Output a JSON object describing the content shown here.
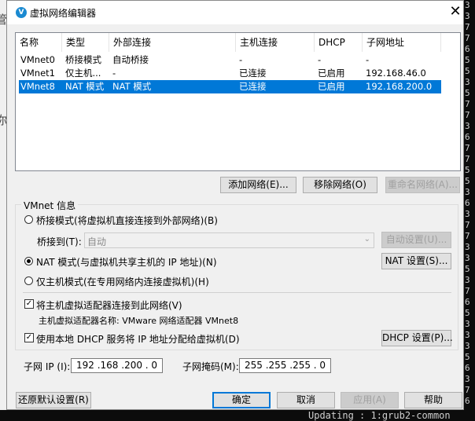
{
  "background": {
    "left_fragments": [
      "管",
      "你"
    ],
    "terminal_bottom": "Updating   : 1:grub2-common",
    "terminal_right": [
      "3",
      "3",
      "7",
      "7",
      "6",
      "5",
      "5",
      "3",
      "5",
      "7",
      "7",
      "3",
      "6",
      "7",
      "7",
      "5",
      "5",
      "3",
      "6",
      "3",
      "7",
      "7",
      "3",
      "3",
      "5",
      "3",
      "7",
      "6",
      "5",
      "3",
      "3",
      "3",
      "5",
      "6",
      "3",
      "7",
      "6"
    ]
  },
  "dialog": {
    "icon": "vmware-icon",
    "title": "虚拟网络编辑器",
    "close_glyph": "✕"
  },
  "list": {
    "columns": [
      "名称",
      "类型",
      "外部连接",
      "主机连接",
      "DHCP",
      "子网地址"
    ],
    "rows": [
      {
        "name": "VMnet0",
        "type": "桥接模式",
        "external": "自动桥接",
        "host": "-",
        "dhcp": "-",
        "subnet": "-",
        "selected": false
      },
      {
        "name": "VMnet1",
        "type": "仅主机...",
        "external": "-",
        "host": "已连接",
        "dhcp": "已启用",
        "subnet": "192.168.46.0",
        "selected": false
      },
      {
        "name": "VMnet8",
        "type": "NAT 模式",
        "external": "NAT 模式",
        "host": "已连接",
        "dhcp": "已启用",
        "subnet": "192.168.200.0",
        "selected": true
      }
    ]
  },
  "list_buttons": {
    "add": "添加网络(E)...",
    "remove": "移除网络(O)",
    "rename": "重命名网络(A)..."
  },
  "vmnet_info": {
    "group_label": "VMnet 信息",
    "bridge_radio": "桥接模式(将虚拟机直接连接到外部网络)(B)",
    "bridge_to_label": "桥接到(T):",
    "bridge_to_value": "自动",
    "auto_settings": "自动设置(U)...",
    "nat_radio": "NAT 模式(与虚拟机共享主机的 IP 地址)(N)",
    "nat_settings": "NAT 设置(S)...",
    "hostonly_radio": "仅主机模式(在专用网络内连接虚拟机)(H)",
    "connect_adapter_check": "将主机虚拟适配器连接到此网络(V)",
    "adapter_name_text": "主机虚拟适配器名称: VMware 网络适配器 VMnet8",
    "dhcp_check": "使用本地 DHCP 服务将 IP 地址分配给虚拟机(D)",
    "dhcp_settings": "DHCP 设置(P)...",
    "subnet_ip_label": "子网 IP (I):",
    "subnet_ip_value": "192 .168 .200 .  0",
    "subnet_mask_label": "子网掩码(M):",
    "subnet_mask_value": "255 .255 .255 .  0",
    "selected_mode": "nat",
    "connect_adapter_checked": true,
    "dhcp_checked": true
  },
  "footer": {
    "restore": "还原默认设置(R)",
    "ok": "确定",
    "cancel": "取消",
    "apply": "应用(A)",
    "help": "帮助"
  },
  "colors": {
    "selection": "#0078d7",
    "dialog_bg": "#f0f0f0",
    "terminal_bg": "#0c0c0c"
  }
}
